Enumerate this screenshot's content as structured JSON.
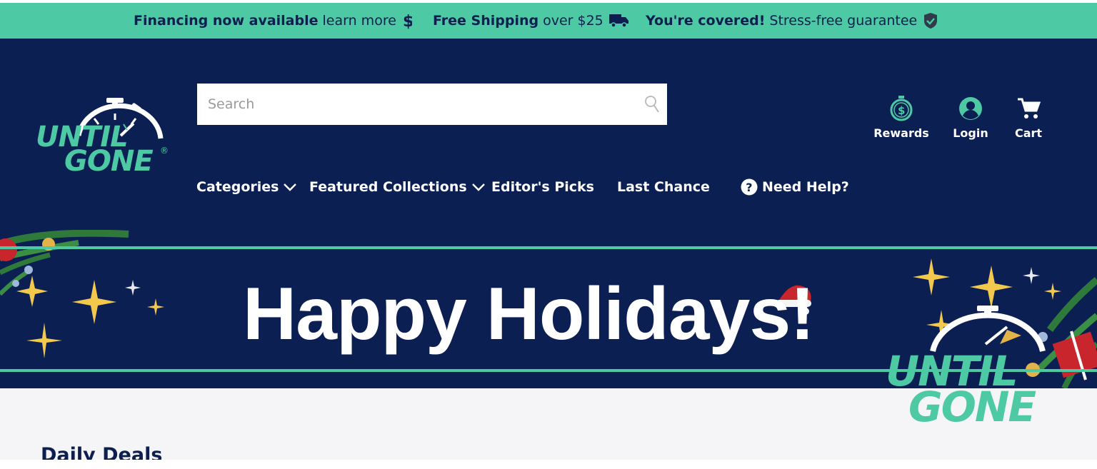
{
  "promo_bar": {
    "financing": {
      "bold": "Financing now available",
      "text": "learn more",
      "icon": "dollar-icon"
    },
    "shipping": {
      "bold": "Free Shipping",
      "text": "over $25",
      "icon": "truck-icon"
    },
    "guarantee": {
      "bold": "You're covered!",
      "text": "Stress-free guarantee",
      "icon": "shield-check-icon"
    }
  },
  "brand": {
    "line1": "UNTIL",
    "line2": "GONE",
    "registered": "®"
  },
  "search": {
    "placeholder": "Search",
    "value": "",
    "icon": "search-icon"
  },
  "nav": {
    "items": [
      {
        "label": "Categories",
        "dropdown": true
      },
      {
        "label": "Featured Collections",
        "dropdown": true
      },
      {
        "label": "Editor's Picks",
        "dropdown": false
      },
      {
        "label": "Last Chance",
        "dropdown": false
      },
      {
        "label": "Need Help?",
        "icon": "help-circle-icon"
      }
    ]
  },
  "account": {
    "rewards": {
      "label": "Rewards",
      "icon": "stopwatch-dollar-icon"
    },
    "login": {
      "label": "Login",
      "icon": "user-circle-icon"
    },
    "cart": {
      "label": "Cart",
      "icon": "cart-icon"
    }
  },
  "banner": {
    "headline": "Happy Holidays!",
    "logo_line1": "UNTIL",
    "logo_line2": "GONE"
  },
  "section": {
    "title": "Daily Deals"
  },
  "colors": {
    "teal": "#4dc9a4",
    "navy": "#0b1f52",
    "text_dark": "#0c1f4f",
    "gold": "#f2c94c"
  }
}
